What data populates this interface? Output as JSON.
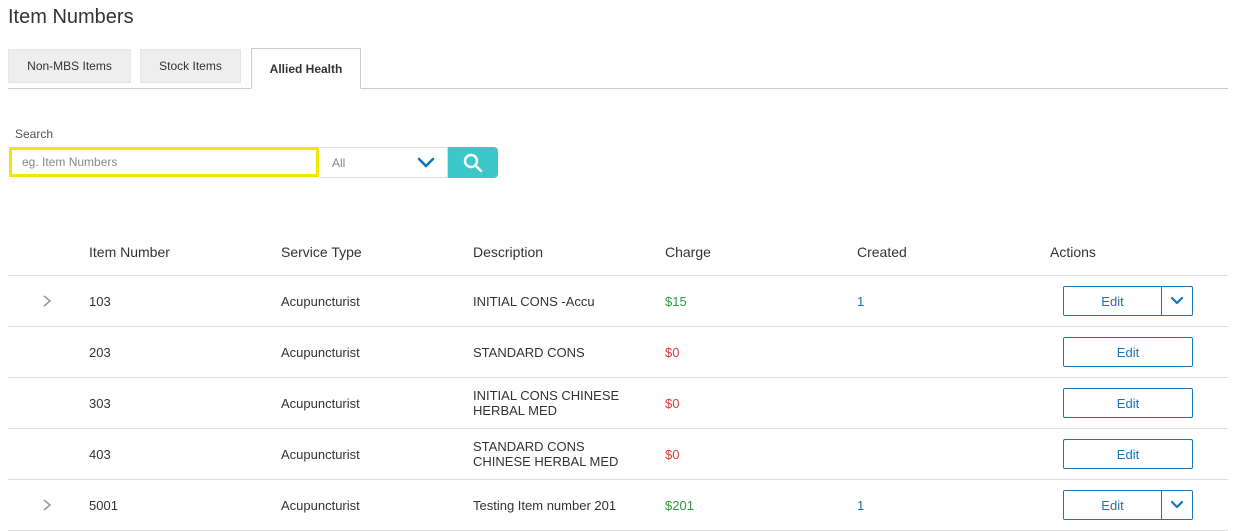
{
  "page": {
    "title": "Item Numbers"
  },
  "tabs": [
    {
      "label": "Non-MBS Items"
    },
    {
      "label": "Stock Items"
    },
    {
      "label": "Allied Health",
      "active": true
    }
  ],
  "search": {
    "label": "Search",
    "placeholder": "eg. Item Numbers",
    "value": "",
    "filter_selected": "All"
  },
  "table": {
    "headers": {
      "item_number": "Item Number",
      "service_type": "Service Type",
      "description": "Description",
      "charge": "Charge",
      "created": "Created",
      "actions": "Actions"
    },
    "rows": [
      {
        "item_number": "103",
        "service_type": "Acupuncturist",
        "description": "INITIAL CONS -Accu",
        "charge": "$15",
        "created": "1",
        "edit_label": "Edit",
        "expandable": true
      },
      {
        "item_number": "203",
        "service_type": "Acupuncturist",
        "description": "STANDARD CONS",
        "charge": "$0",
        "created": "",
        "edit_label": "Edit",
        "expandable": false
      },
      {
        "item_number": "303",
        "service_type": "Acupuncturist",
        "description": "INITIAL CONS CHINESE HERBAL MED",
        "charge": "$0",
        "created": "",
        "edit_label": "Edit",
        "expandable": false
      },
      {
        "item_number": "403",
        "service_type": "Acupuncturist",
        "description": "STANDARD CONS CHINESE HERBAL MED",
        "charge": "$0",
        "created": "",
        "edit_label": "Edit",
        "expandable": false
      },
      {
        "item_number": "5001",
        "service_type": "Acupuncturist",
        "description": "Testing Item number 201",
        "charge": "$201",
        "created": "1",
        "edit_label": "Edit",
        "expandable": true
      }
    ]
  },
  "colors": {
    "accent_teal": "#3cc8c8",
    "link_blue": "#1a74b8",
    "charge_positive": "#2e9a3e",
    "charge_zero": "#e03a3a",
    "focus_outline": "#f5e600"
  },
  "icons": {
    "search": "search-icon",
    "dropdown": "chevron-down-icon",
    "expand": "chevron-right-icon"
  }
}
